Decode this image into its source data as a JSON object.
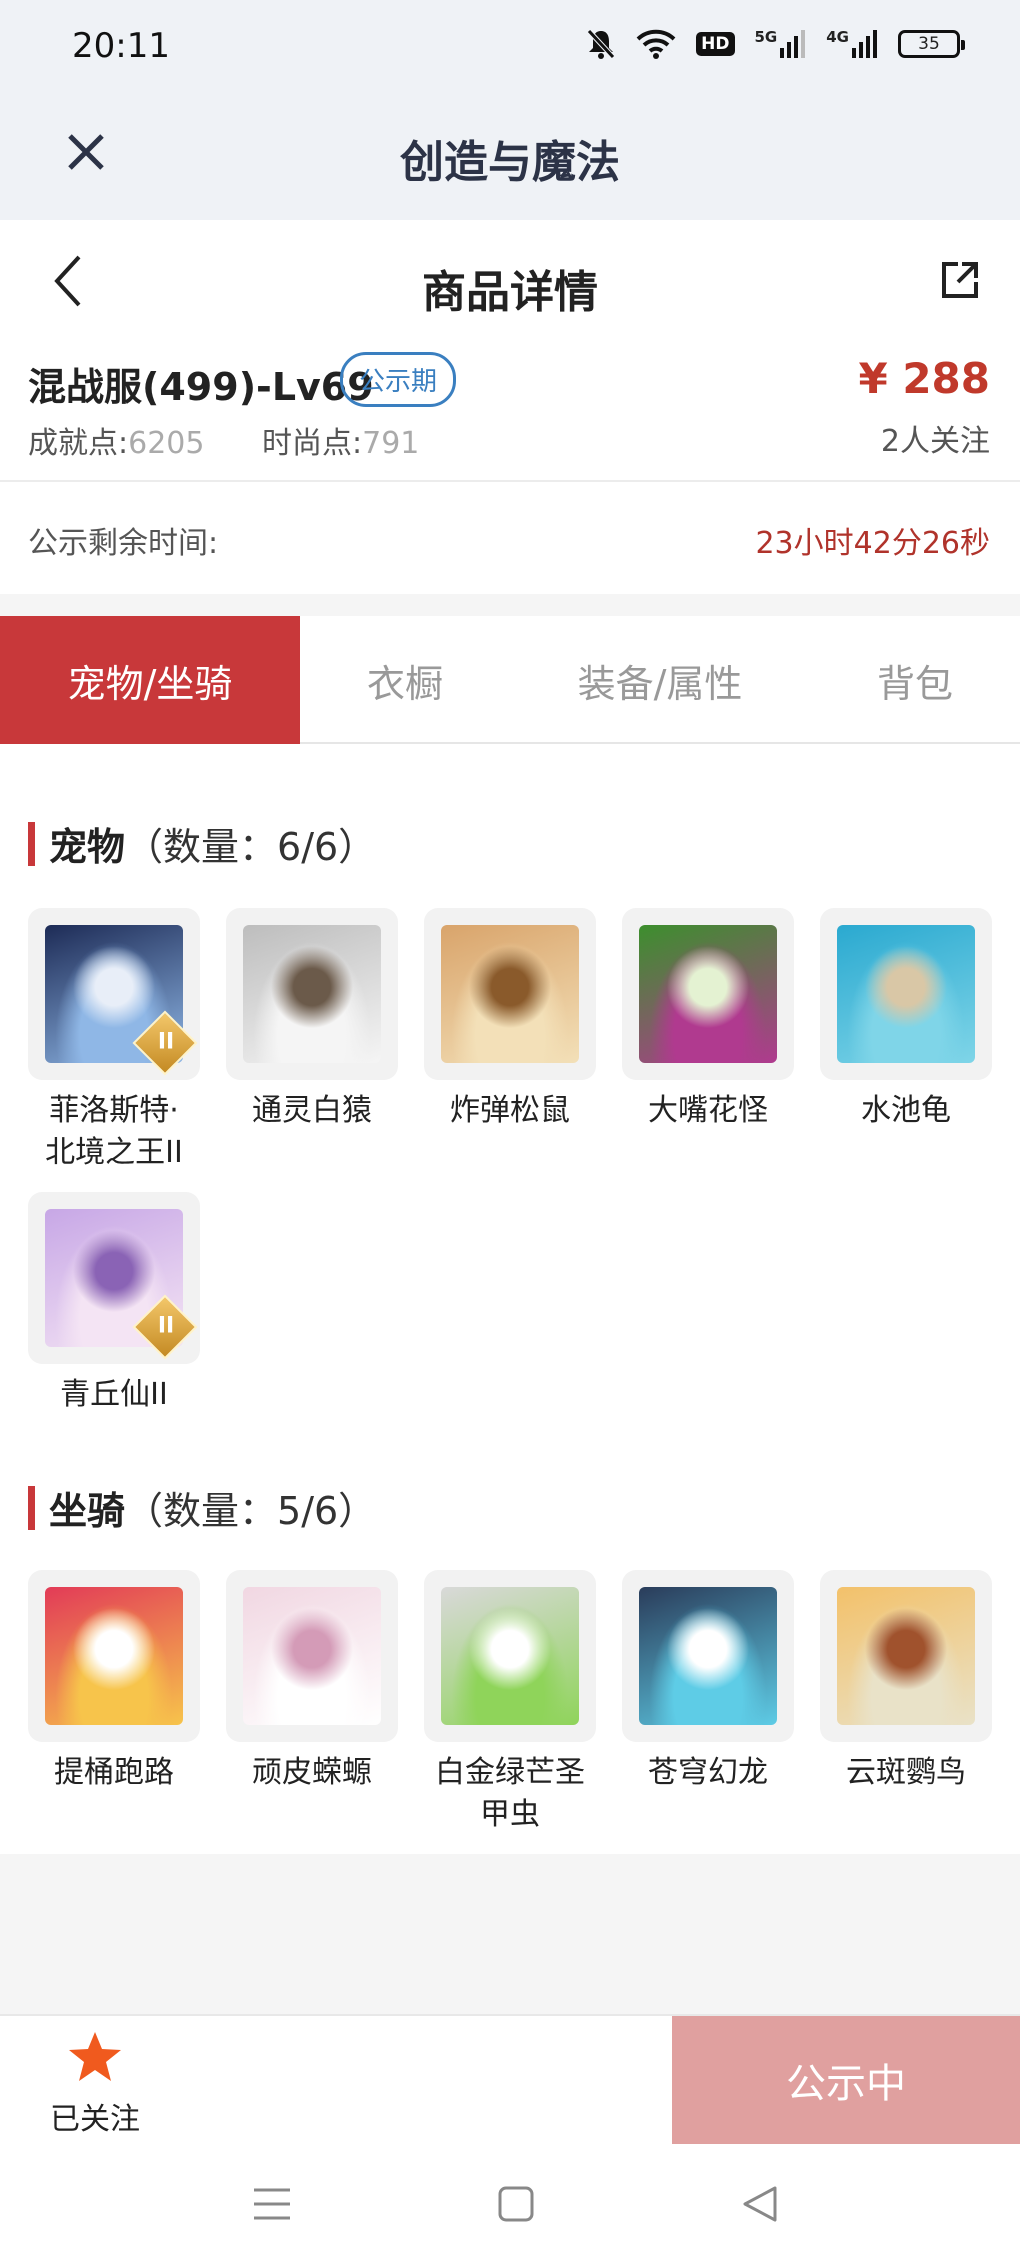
{
  "status_bar": {
    "time": "20:11",
    "network_5g": "5G",
    "network_4g": "4G",
    "hd_label": "HD",
    "battery": "35"
  },
  "titlebar": {
    "title": "创造与魔法"
  },
  "header": {
    "title": "商品详情"
  },
  "product": {
    "name": "混战服(499)-Lv69",
    "badge": "公示期",
    "price": "¥ 288",
    "followers": "2人关注",
    "achievement_label": "成就点:",
    "achievement_value": "6205",
    "fashion_label": "时尚点:",
    "fashion_value": "791"
  },
  "timer": {
    "label": "公示剩余时间:",
    "value": "23小时42分26秒"
  },
  "tabs": [
    {
      "label": "宠物/坐骑",
      "active": true
    },
    {
      "label": "衣橱",
      "active": false
    },
    {
      "label": "装备/属性",
      "active": false
    },
    {
      "label": "背包",
      "active": false
    }
  ],
  "pets": {
    "title": "宠物",
    "count": "（数量：6/6）",
    "items": [
      {
        "name": "菲洛斯特·\n北境之王II",
        "tier": "II",
        "colors": [
          "#1d2b56",
          "#8fb7e6",
          "#e8eef8"
        ]
      },
      {
        "name": "通灵白猿",
        "colors": [
          "#bdbdbd",
          "#f5f5f5",
          "#6b5a4a"
        ]
      },
      {
        "name": "炸弹松鼠",
        "colors": [
          "#d9a46b",
          "#f3e0b8",
          "#8a5a2b"
        ]
      },
      {
        "name": "大嘴花怪",
        "colors": [
          "#3c8f2d",
          "#b03a8f",
          "#e4f2d2"
        ]
      },
      {
        "name": "水池龟",
        "colors": [
          "#2aa9d0",
          "#7fd5e8",
          "#d9c7a6"
        ]
      },
      {
        "name": "青丘仙II",
        "tier": "II",
        "colors": [
          "#c7a7e6",
          "#f4e4f4",
          "#8a63b5"
        ]
      }
    ]
  },
  "mounts": {
    "title": "坐骑",
    "count": "（数量：5/6）",
    "items": [
      {
        "name": "提桶跑路",
        "colors": [
          "#e23b57",
          "#f7c44b",
          "#ffffff"
        ]
      },
      {
        "name": "顽皮蝾螈",
        "colors": [
          "#f1d7e2",
          "#ffffff",
          "#d49bb7"
        ]
      },
      {
        "name": "白金绿芒圣\n甲虫",
        "colors": [
          "#d9d9d9",
          "#8fd45a",
          "#ffffff"
        ]
      },
      {
        "name": "苍穹幻龙",
        "colors": [
          "#2a3c5a",
          "#5ecce6",
          "#ffffff"
        ]
      },
      {
        "name": "云斑鹦鸟",
        "colors": [
          "#f3c16a",
          "#e9e2c8",
          "#a0522d"
        ]
      }
    ]
  },
  "bottom": {
    "follow_label": "已关注",
    "cta_label": "公示中"
  }
}
